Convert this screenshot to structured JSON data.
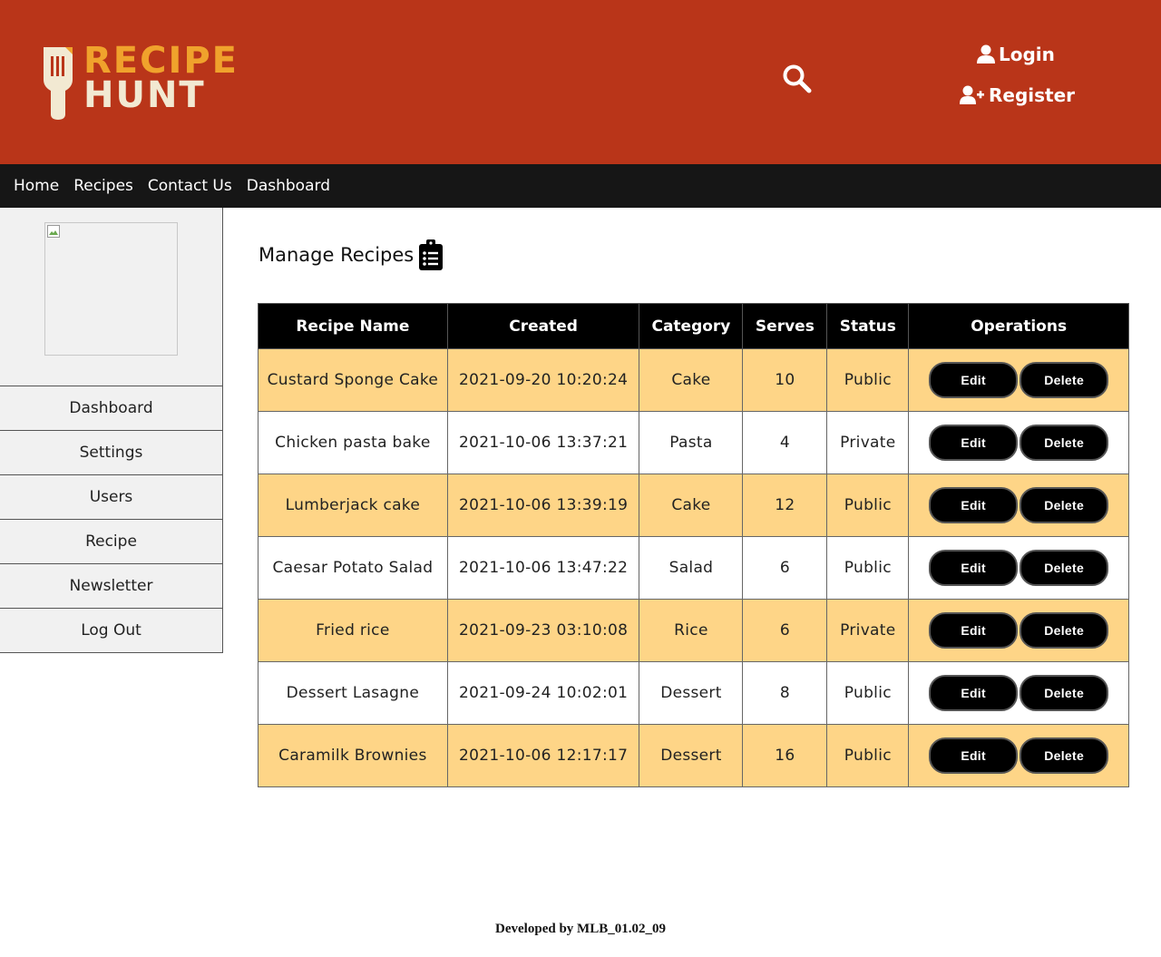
{
  "header": {
    "logo_line1": "RECIPE",
    "logo_line2": "HUNT",
    "search_icon": "search-icon",
    "login_label": "Login",
    "register_label": "Register"
  },
  "nav": {
    "items": [
      "Home",
      "Recipes",
      "Contact Us",
      "Dashboard"
    ]
  },
  "sidebar": {
    "items": [
      "Dashboard",
      "Settings",
      "Users",
      "Recipe",
      "Newsletter",
      "Log Out"
    ]
  },
  "main": {
    "title": "Manage Recipes",
    "title_icon": "clipboard-list-icon",
    "columns": [
      "Recipe Name",
      "Created",
      "Category",
      "Serves",
      "Status",
      "Operations"
    ],
    "rows": [
      {
        "name": "Custard Sponge Cake",
        "created": "2021-09-20 10:20:24",
        "category": "Cake",
        "serves": "10",
        "status": "Public"
      },
      {
        "name": "Chicken pasta bake",
        "created": "2021-10-06 13:37:21",
        "category": "Pasta",
        "serves": "4",
        "status": "Private"
      },
      {
        "name": "Lumberjack cake",
        "created": "2021-10-06 13:39:19",
        "category": "Cake",
        "serves": "12",
        "status": "Public"
      },
      {
        "name": "Caesar Potato Salad",
        "created": "2021-10-06 13:47:22",
        "category": "Salad",
        "serves": "6",
        "status": "Public"
      },
      {
        "name": "Fried rice",
        "created": "2021-09-23 03:10:08",
        "category": "Rice",
        "serves": "6",
        "status": "Private"
      },
      {
        "name": "Dessert Lasagne",
        "created": "2021-09-24 10:02:01",
        "category": "Dessert",
        "serves": "8",
        "status": "Public"
      },
      {
        "name": "Caramilk Brownies",
        "created": "2021-10-06 12:17:17",
        "category": "Dessert",
        "serves": "16",
        "status": "Public"
      }
    ],
    "edit_label": "Edit",
    "delete_label": "Delete"
  },
  "footer": {
    "text": "Developed by MLB_01.02_09"
  },
  "colors": {
    "header_bg": "#b93519",
    "nav_bg": "#161616",
    "row_highlight": "#fed587",
    "logo_accent": "#f0a22c",
    "logo_light": "#f2e9d2"
  }
}
